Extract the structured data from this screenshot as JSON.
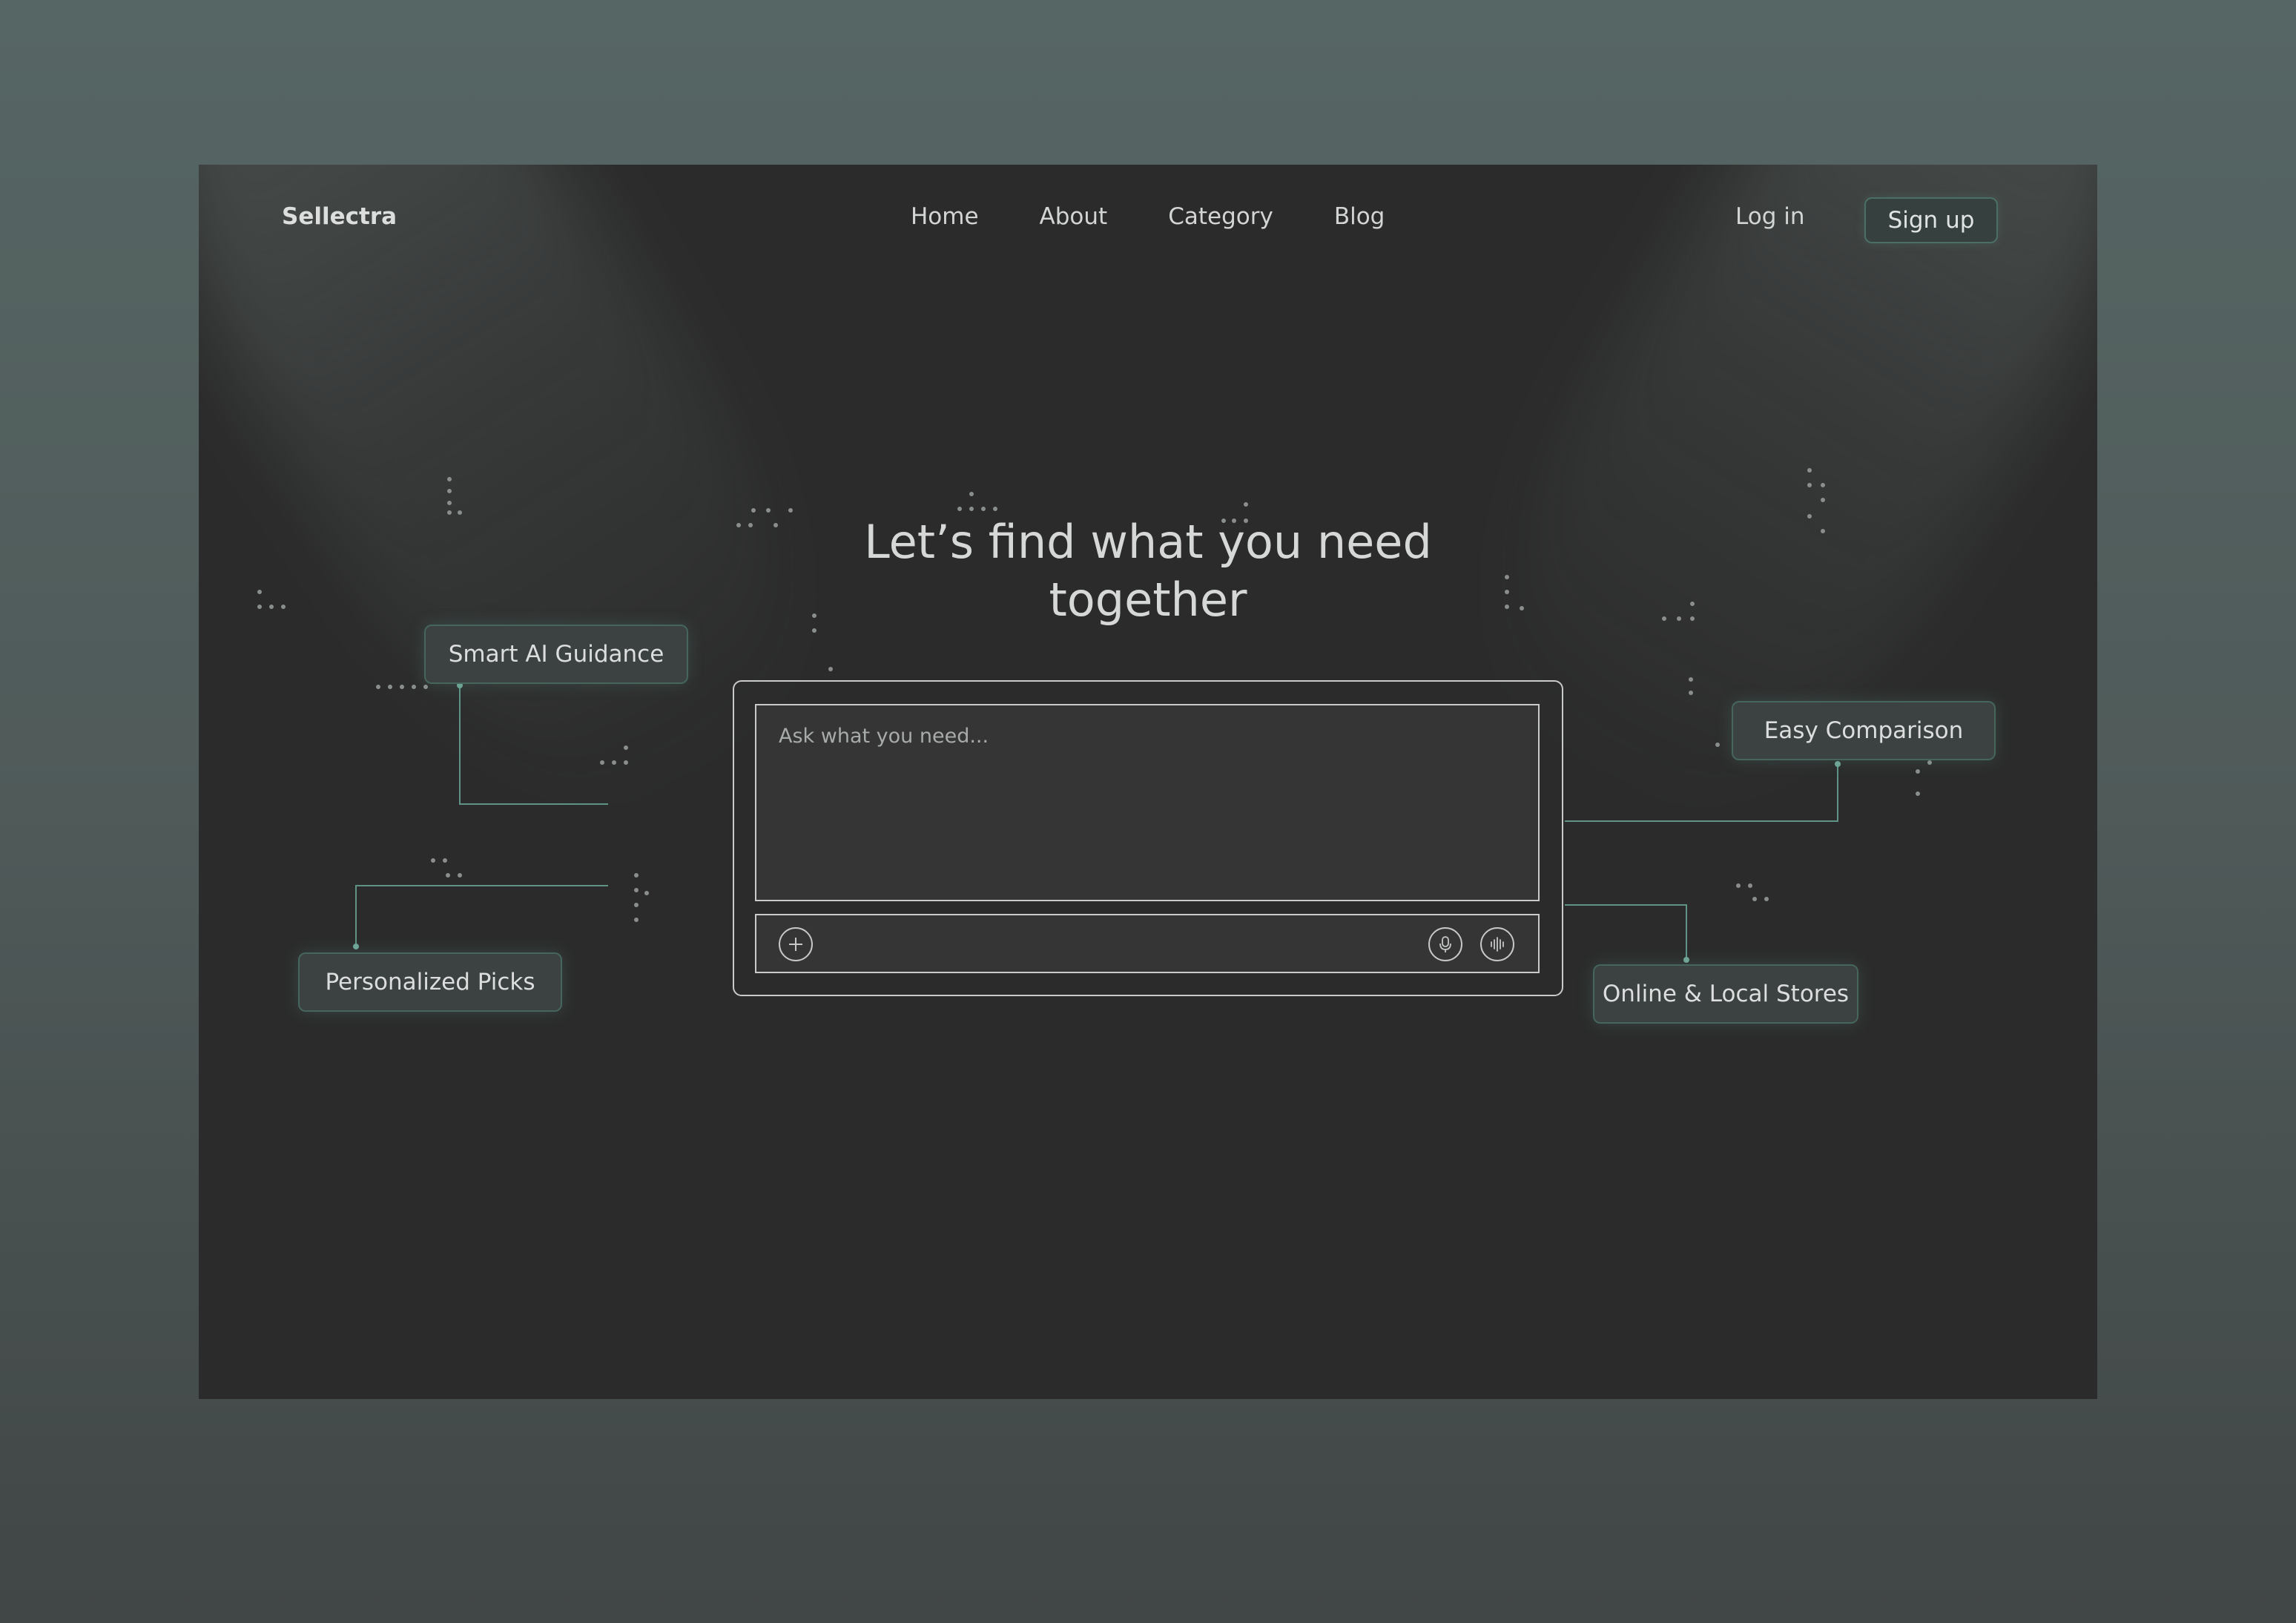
{
  "brand": "Sellectra",
  "nav": {
    "items": [
      "Home",
      "About",
      "Category",
      "Blog"
    ]
  },
  "auth": {
    "login_label": "Log in",
    "signup_label": "Sign up"
  },
  "hero": {
    "title_line1": "Let’s find what you need",
    "title_line2": "together"
  },
  "search": {
    "placeholder": "Ask what you need...",
    "value": ""
  },
  "features": {
    "smart_ai": "Smart AI Guidance",
    "personalized": "Personalized Picks",
    "comparison": "Easy Comparison",
    "stores": "Online & Local Stores"
  },
  "icons": {
    "add": "plus-icon",
    "mic": "microphone-icon",
    "voice": "waveform-icon"
  },
  "colors": {
    "page_bg": "#2b2b2b",
    "accent": "#5e9385",
    "backdrop": "#536260"
  }
}
